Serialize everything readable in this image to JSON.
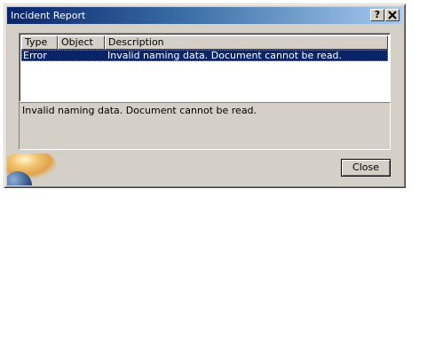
{
  "window": {
    "title": "Incident Report",
    "help_label": "?",
    "close_label": "✕"
  },
  "list": {
    "columns": [
      "Type",
      "Object",
      "Description"
    ],
    "rows": [
      {
        "type": "Error",
        "object": "",
        "description": "Invalid naming data. Document cannot be read.",
        "selected": true
      }
    ]
  },
  "detail": {
    "text": "Invalid naming data. Document cannot be read."
  },
  "buttons": {
    "close": "Close"
  },
  "colors": {
    "title_start": "#0a246a",
    "title_end": "#a6caf0",
    "selection": "#0a246a",
    "dialog_face": "#d4d0c8"
  },
  "icons": {
    "logo": "planet-logo-icon"
  }
}
